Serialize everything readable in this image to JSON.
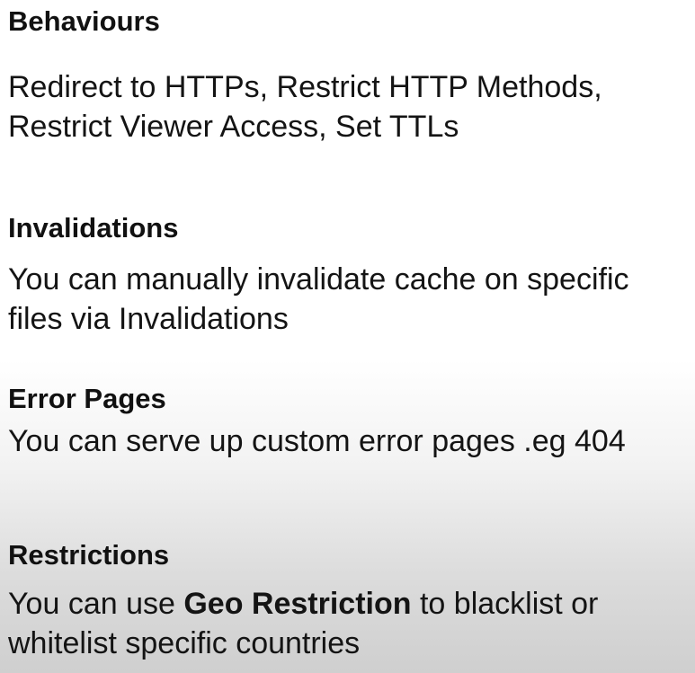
{
  "sections": [
    {
      "heading": "Behaviours",
      "body": "Redirect to HTTPs, Restrict HTTP Methods,\nRestrict Viewer Access, Set TTLs"
    },
    {
      "heading": "Invalidations",
      "body": "You can manually invalidate cache on specific\nfiles via Invalidations"
    },
    {
      "heading": "Error Pages",
      "body": "You can serve up custom error pages .eg 404"
    },
    {
      "heading": "Restrictions",
      "body_prefix": "You can use ",
      "body_bold": "Geo Restriction",
      "body_suffix": " to blacklist or\nwhitelist specific countries"
    }
  ]
}
